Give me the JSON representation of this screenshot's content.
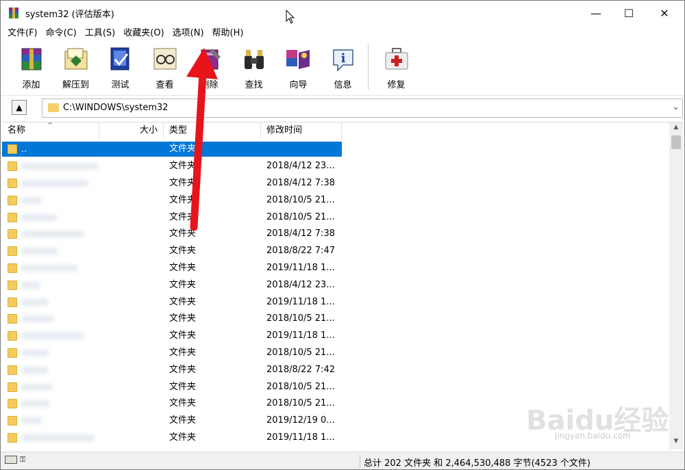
{
  "window": {
    "title": "system32 (评估版本)",
    "controls": {
      "minimize": "—",
      "maximize": "☐",
      "close": "✕"
    }
  },
  "menu": [
    "文件(F)",
    "命令(C)",
    "工具(S)",
    "收藏夹(O)",
    "选项(N)",
    "帮助(H)"
  ],
  "toolbar": {
    "items": [
      {
        "label": "添加",
        "icon": "add-archive-icon"
      },
      {
        "label": "解压到",
        "icon": "extract-icon"
      },
      {
        "label": "测试",
        "icon": "test-icon"
      },
      {
        "label": "查看",
        "icon": "view-icon"
      },
      {
        "label": "删除",
        "icon": "delete-icon"
      },
      {
        "label": "查找",
        "icon": "find-icon"
      },
      {
        "label": "向导",
        "icon": "wizard-icon"
      },
      {
        "label": "信息",
        "icon": "info-icon"
      },
      {
        "label": "修复",
        "icon": "repair-icon"
      }
    ]
  },
  "address": {
    "path": "C:\\WINDOWS\\system32"
  },
  "columns": {
    "name": "名称",
    "size": "大小",
    "type": "类型",
    "modified": "修改时间"
  },
  "rows": [
    {
      "name": "..",
      "type": "文件夹",
      "modified": "",
      "selected": true
    },
    {
      "name": "",
      "type": "文件夹",
      "modified": "2018/4/12 23..."
    },
    {
      "name": "",
      "type": "文件夹",
      "modified": "2018/4/12 7:38"
    },
    {
      "name": "",
      "type": "文件夹",
      "modified": "2018/10/5 21..."
    },
    {
      "name": "",
      "type": "文件夹",
      "modified": "2018/10/5 21..."
    },
    {
      "name": "",
      "type": "文件夹",
      "modified": "2018/4/12 7:38"
    },
    {
      "name": "",
      "type": "文件夹",
      "modified": "2018/8/22 7:47"
    },
    {
      "name": "",
      "type": "文件夹",
      "modified": "2019/11/18 1..."
    },
    {
      "name": "",
      "type": "文件夹",
      "modified": "2018/4/12 23..."
    },
    {
      "name": "",
      "type": "文件夹",
      "modified": "2019/11/18 1..."
    },
    {
      "name": "",
      "type": "文件夹",
      "modified": "2018/10/5 21..."
    },
    {
      "name": "",
      "type": "文件夹",
      "modified": "2019/11/18 1..."
    },
    {
      "name": "",
      "type": "文件夹",
      "modified": "2018/10/5 21..."
    },
    {
      "name": "",
      "type": "文件夹",
      "modified": "2018/8/22 7:42"
    },
    {
      "name": "",
      "type": "文件夹",
      "modified": "2018/10/5 21..."
    },
    {
      "name": "",
      "type": "文件夹",
      "modified": "2018/10/5 21..."
    },
    {
      "name": "",
      "type": "文件夹",
      "modified": "2019/12/19 0..."
    },
    {
      "name": "",
      "type": "文件夹",
      "modified": "2019/11/18 1..."
    }
  ],
  "status": {
    "summary": "总计 202 文件夹 和 2,464,530,488 字节(4523 个文件)"
  },
  "watermark": {
    "brand": "Baidu经验",
    "url": "jingyan.baidu.com"
  },
  "colors": {
    "selection": "#0078d7",
    "annotation_arrow": "#e8141c",
    "folder": "#f3cc5c"
  }
}
